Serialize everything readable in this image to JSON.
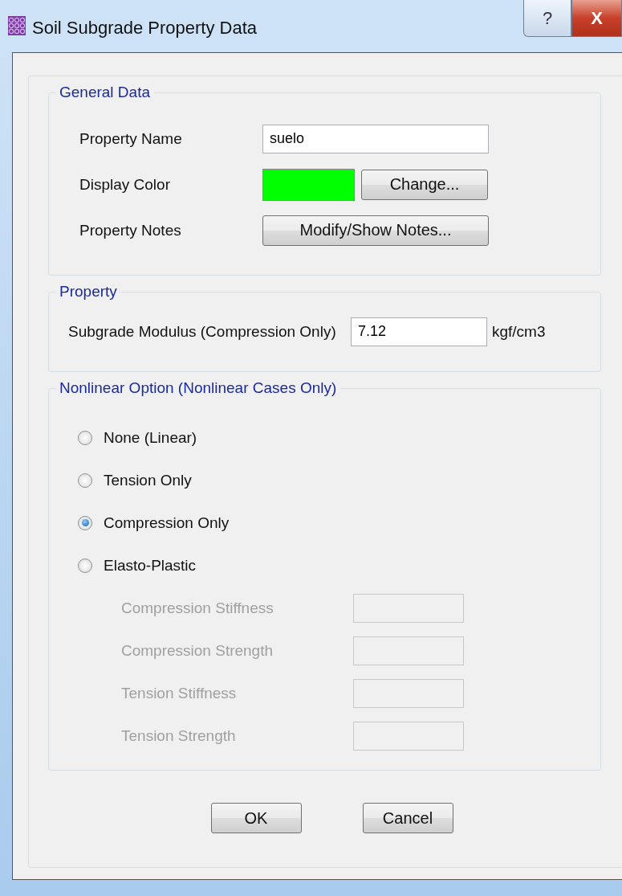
{
  "window": {
    "title": "Soil Subgrade Property Data",
    "controls": [
      "?",
      "X"
    ]
  },
  "general_data": {
    "title": "General Data",
    "property_name": {
      "label": "Property Name",
      "value": "suelo"
    },
    "display_color": {
      "label": "Display Color",
      "color": "#00ff00",
      "button": "Change..."
    },
    "property_notes": {
      "label": "Property Notes",
      "button": "Modify/Show Notes..."
    }
  },
  "property": {
    "title": "Property",
    "label": "Subgrade Modulus  (Compression Only)",
    "value": "7.12",
    "unit": "kgf/cm3"
  },
  "nonlinear_option": {
    "title": "Nonlinear Option  (Nonlinear Cases Only)",
    "options": [
      {
        "label": "None (Linear)",
        "selected": false
      },
      {
        "label": "Tension Only",
        "selected": false
      },
      {
        "label": "Compression Only",
        "selected": true
      },
      {
        "label": "Elasto-Plastic",
        "selected": false
      }
    ],
    "parameters": [
      {
        "label": "Compression Stiffness",
        "disabled": true
      },
      {
        "label": "Compression Strength",
        "disabled": true
      },
      {
        "label": "Tension Stiffness",
        "disabled": true
      },
      {
        "label": "Tension Strength",
        "disabled": true
      }
    ]
  },
  "buttons": [
    "OK",
    "Cancel"
  ]
}
